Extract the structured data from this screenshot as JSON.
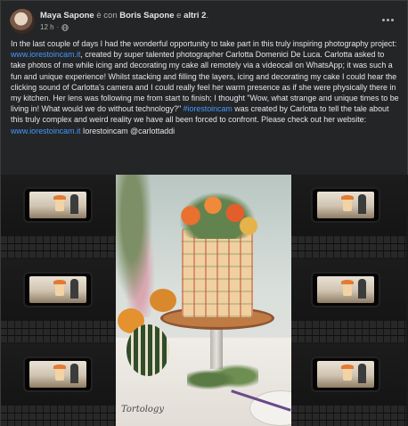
{
  "post": {
    "author": "Maya Sapone",
    "with_word": "è con",
    "tagged": "Boris Sapone",
    "and_word": "e",
    "others": "altri 2",
    "time": "12 h",
    "privacy_icon": "globe-icon",
    "more_icon": "more-options-icon",
    "body": {
      "t1": "In the last couple of days I had the wonderful opportunity to take part in this truly inspiring photography project: ",
      "link1": "www.iorestoincam.it",
      "t2": ", created by super talented photographer Carlotta Domenici De Luca. Carlotta asked to take photos of me while icing and decorating my cake all remotely via a videocall on WhatsApp; it was such a fun and unique experience! Whilst stacking and filling the layers, icing and decorating my cake I could hear the clicking sound of Carlotta's camera and I could really feel her warm presence as if she were physically there in my kitchen. Her lens was following me from start to finish; I thought \"Wow, what strange and unique times to be living in! What would we do without technology?\" ",
      "hashtag": "#iorestoincam",
      "t3": " was created by Carlotta to tell the tale about this truly complex and weird reality we have all been forced to confront. Please check out her website: ",
      "link2": "www.iorestoincam.it",
      "t4": " Iorestoincam @carlottaddi"
    }
  },
  "media": {
    "watermark": "Tortology",
    "colors": {
      "link": "#4599ff",
      "background": "#242526",
      "text": "#e4e6eb",
      "muted": "#b0b3b8"
    }
  }
}
